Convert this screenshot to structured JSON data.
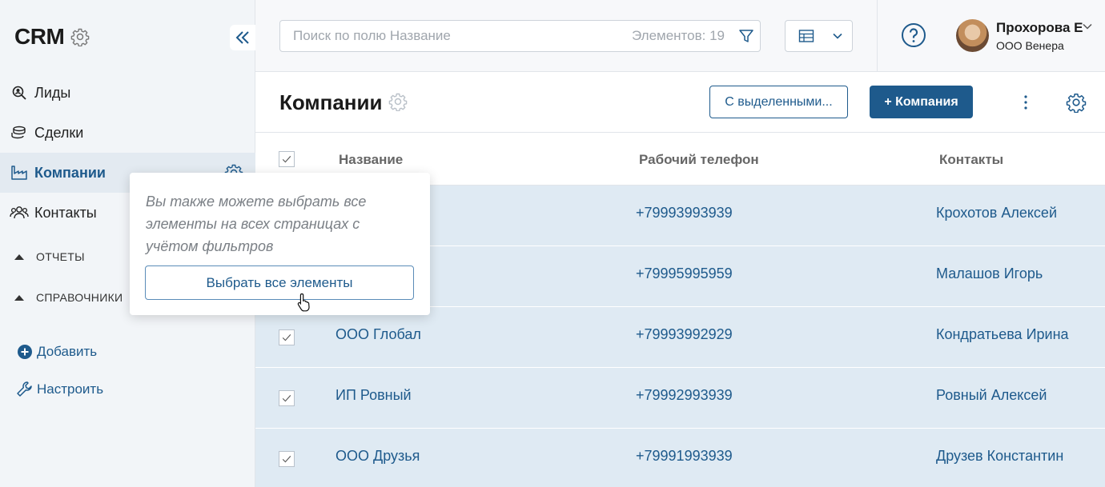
{
  "sidebar": {
    "brand": "CRM",
    "nav": [
      {
        "label": "Лиды",
        "icon": "search-person-icon"
      },
      {
        "label": "Сделки",
        "icon": "coins-icon"
      },
      {
        "label": "Компании",
        "icon": "factory-icon"
      },
      {
        "label": "Контакты",
        "icon": "people-icon"
      }
    ],
    "groups": [
      "ОТЧЕТЫ",
      "СПРАВОЧНИКИ"
    ],
    "add_label": "Добавить",
    "configure_label": "Настроить"
  },
  "topbar": {
    "search_placeholder": "Поиск по полю Название",
    "count_text": "Элементов: 19",
    "user_name": "Прохорова Е",
    "user_org": "ООО Венера"
  },
  "page": {
    "title": "Компании",
    "bulk_button": "С выделенными...",
    "add_button": "+ Компания"
  },
  "table": {
    "columns": [
      "Название",
      "Рабочий телефон",
      "Контакты"
    ],
    "rows": [
      {
        "name": "",
        "phone": "+79993993939",
        "contact": "Крохотов Алексей"
      },
      {
        "name": "",
        "phone": "+79995995959",
        "contact": "Малашов Игорь"
      },
      {
        "name": "ООО Глобал",
        "phone": "+79993992929",
        "contact": "Кондратьева Ирина"
      },
      {
        "name": "ИП Ровный",
        "phone": "+79992993939",
        "contact": "Ровный Алексей"
      },
      {
        "name": "ООО Друзья",
        "phone": "+79991993939",
        "contact": "Друзев Константин"
      }
    ]
  },
  "popover": {
    "text": "Вы также можете выбрать все элементы на всех страницах с учётом фильтров",
    "button": "Выбрать все элементы"
  },
  "colors": {
    "accent": "#1e5a8c",
    "sidebar_bg": "#f2f5f8",
    "row_selected": "#dfeaf3"
  }
}
